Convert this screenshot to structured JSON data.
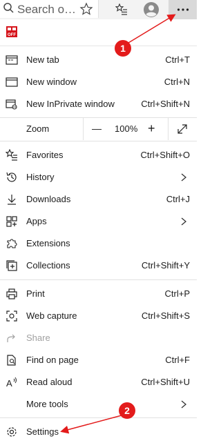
{
  "toolbar": {
    "search_text": "Search o…"
  },
  "menu": {
    "new_tab": {
      "label": "New tab",
      "shortcut": "Ctrl+T"
    },
    "new_window": {
      "label": "New window",
      "shortcut": "Ctrl+N"
    },
    "new_inprivate": {
      "label": "New InPrivate window",
      "shortcut": "Ctrl+Shift+N"
    },
    "zoom": {
      "label": "Zoom",
      "minus": "—",
      "value": "100%",
      "plus": "+"
    },
    "favorites": {
      "label": "Favorites",
      "shortcut": "Ctrl+Shift+O"
    },
    "history": {
      "label": "History"
    },
    "downloads": {
      "label": "Downloads",
      "shortcut": "Ctrl+J"
    },
    "apps": {
      "label": "Apps"
    },
    "extensions": {
      "label": "Extensions"
    },
    "collections": {
      "label": "Collections",
      "shortcut": "Ctrl+Shift+Y"
    },
    "print": {
      "label": "Print",
      "shortcut": "Ctrl+P"
    },
    "web_capture": {
      "label": "Web capture",
      "shortcut": "Ctrl+Shift+S"
    },
    "share": {
      "label": "Share"
    },
    "find_on_page": {
      "label": "Find on page",
      "shortcut": "Ctrl+F"
    },
    "read_aloud": {
      "label": "Read aloud",
      "shortcut": "Ctrl+Shift+U"
    },
    "more_tools": {
      "label": "More tools"
    },
    "settings": {
      "label": "Settings"
    }
  },
  "annotations": {
    "callout_1": "1",
    "callout_2": "2"
  },
  "colors": {
    "annotation_red": "#e31b1b",
    "disabled_text": "#a0a0a0"
  }
}
